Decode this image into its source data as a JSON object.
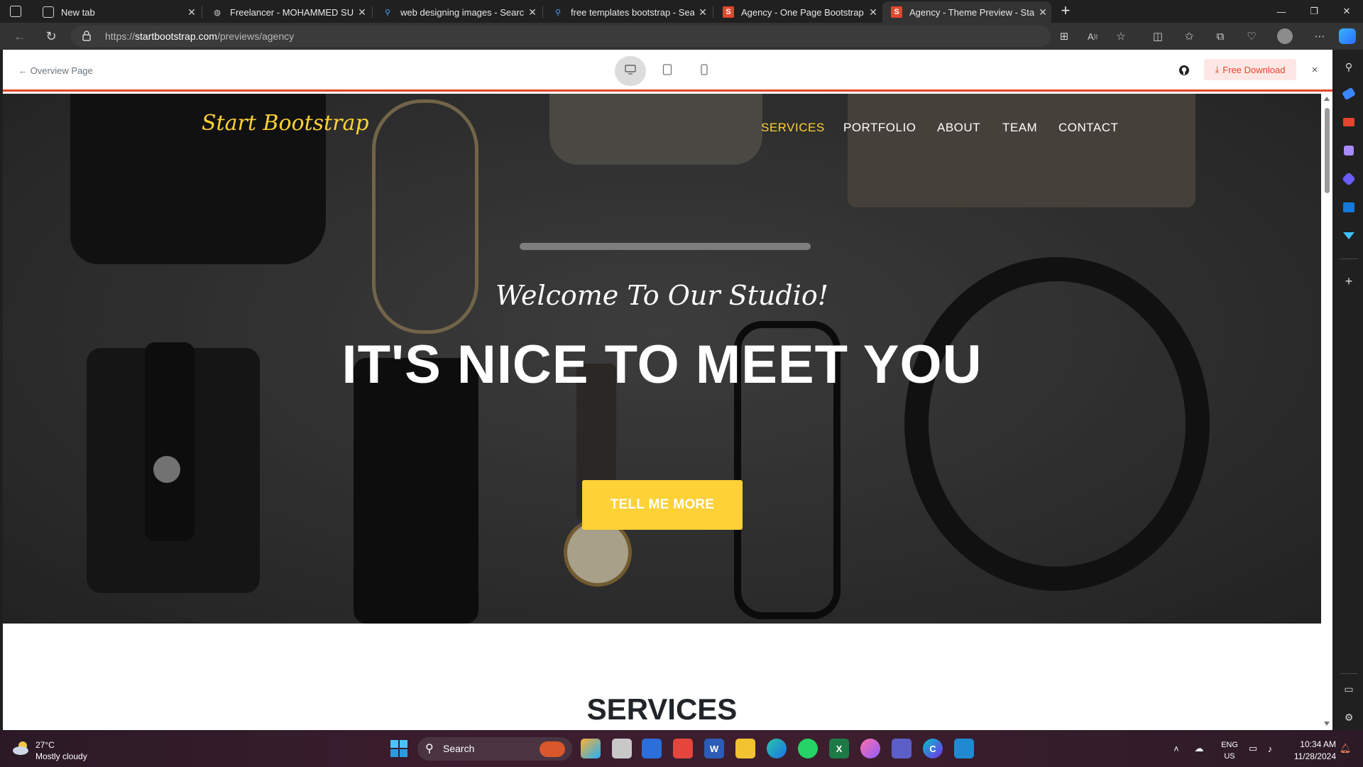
{
  "browser": {
    "tabs": [
      {
        "title": "New tab",
        "icon": "newtab-icon"
      },
      {
        "title": "Freelancer - MOHAMMED SUHA",
        "icon": "globe-icon"
      },
      {
        "title": "web designing images - Search",
        "icon": "search-icon"
      },
      {
        "title": "free templates bootstrap - Search",
        "icon": "search-icon"
      },
      {
        "title": "Agency - One Page Bootstrap Th",
        "icon": "startbootstrap-icon"
      },
      {
        "title": "Agency - Theme Preview - Start B",
        "icon": "startbootstrap-icon",
        "active": true
      }
    ],
    "new_tab_glyph": "+",
    "url_prefix": "https://",
    "url_domain": "startbootstrap.com",
    "url_path": "/previews/agency"
  },
  "preview_bar": {
    "overview_label": "← Overview Page",
    "download_label": "Free Download",
    "close_glyph": "×"
  },
  "site": {
    "brand": "Start Bootstrap",
    "nav": [
      "SERVICES",
      "PORTFOLIO",
      "ABOUT",
      "TEAM",
      "CONTACT"
    ],
    "active_nav": "SERVICES",
    "hero_subtitle": "Welcome To Our Studio!",
    "hero_title": "IT'S NICE TO MEET YOU",
    "cta_label": "TELL ME MORE",
    "services_heading": "SERVICES",
    "accent_color": "#fed136"
  },
  "taskbar": {
    "weather_temp": "27°C",
    "weather_desc": "Mostly cloudy",
    "search_label": "Search",
    "lang_line1": "ENG",
    "lang_line2": "US",
    "time": "10:34 AM",
    "date": "11/28/2024"
  }
}
